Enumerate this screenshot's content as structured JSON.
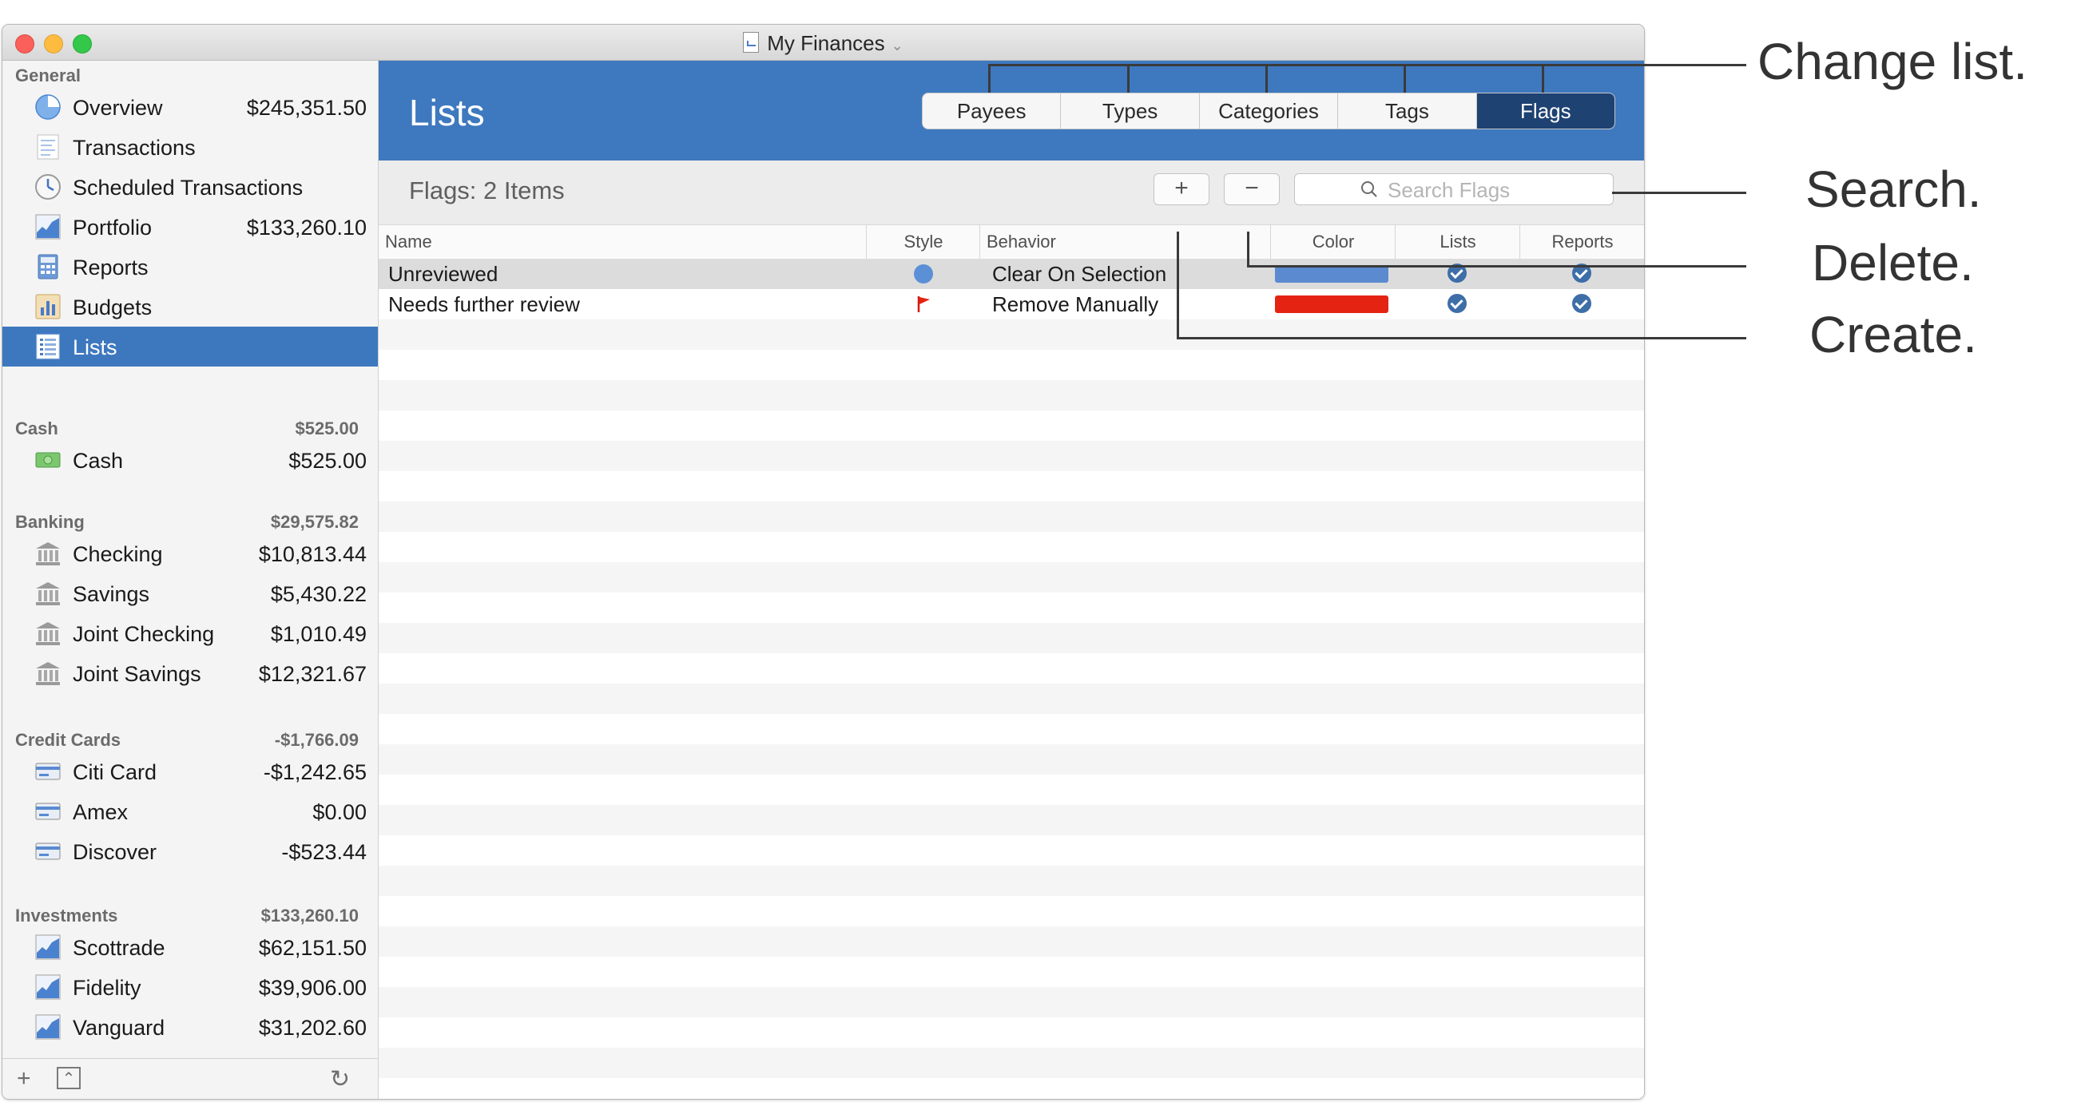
{
  "window": {
    "title": "My Finances"
  },
  "sidebar": {
    "sections": {
      "general": {
        "label": "General"
      },
      "cash": {
        "label": "Cash",
        "total": "$525.00"
      },
      "banking": {
        "label": "Banking",
        "total": "$29,575.82"
      },
      "credit": {
        "label": "Credit Cards",
        "total": "-$1,766.09"
      },
      "investments": {
        "label": "Investments",
        "total": "$133,260.10"
      }
    },
    "items": [
      {
        "label": "Overview",
        "amount": "$245,351.50"
      },
      {
        "label": "Transactions",
        "amount": ""
      },
      {
        "label": "Scheduled Transactions",
        "amount": ""
      },
      {
        "label": "Portfolio",
        "amount": "$133,260.10"
      },
      {
        "label": "Reports",
        "amount": ""
      },
      {
        "label": "Budgets",
        "amount": ""
      },
      {
        "label": "Lists",
        "amount": ""
      },
      {
        "label": "Cash",
        "amount": "$525.00"
      },
      {
        "label": "Checking",
        "amount": "$10,813.44"
      },
      {
        "label": "Savings",
        "amount": "$5,430.22"
      },
      {
        "label": "Joint Checking",
        "amount": "$1,010.49"
      },
      {
        "label": "Joint Savings",
        "amount": "$12,321.67"
      },
      {
        "label": "Citi Card",
        "amount": "-$1,242.65"
      },
      {
        "label": "Amex",
        "amount": "$0.00"
      },
      {
        "label": "Discover",
        "amount": "-$523.44"
      },
      {
        "label": "Scottrade",
        "amount": "$62,151.50"
      },
      {
        "label": "Fidelity",
        "amount": "$39,906.00"
      },
      {
        "label": "Vanguard",
        "amount": "$31,202.60"
      }
    ],
    "selected": "Lists",
    "footer": {
      "add": "+",
      "collapse": "⌃",
      "refresh": "↻"
    }
  },
  "header": {
    "title": "Lists",
    "tabs": [
      "Payees",
      "Types",
      "Categories",
      "Tags",
      "Flags"
    ],
    "active_tab": "Flags"
  },
  "toolbar": {
    "count": "Flags: 2 Items",
    "add_label": "+",
    "remove_label": "−",
    "search_placeholder": "Search Flags"
  },
  "table": {
    "columns": {
      "name": "Name",
      "style": "Style",
      "behavior": "Behavior",
      "color": "Color",
      "lists": "Lists",
      "reports": "Reports"
    },
    "rows": [
      {
        "name": "Unreviewed",
        "style": "dot-icon",
        "behavior": "Clear On Selection",
        "color": "#5b8ad0",
        "lists": true,
        "reports": true
      },
      {
        "name": "Needs further review",
        "style": "flag-icon",
        "behavior": "Remove Manually",
        "color": "#e42313",
        "lists": true,
        "reports": true
      }
    ]
  },
  "annotations": {
    "change_list": "Change list.",
    "search": "Search.",
    "delete": "Delete.",
    "create": "Create."
  },
  "colors": {
    "accent": "#3e79bf",
    "selected_tab": "#1e4272",
    "sidebar_selected": "#3d78bf"
  }
}
